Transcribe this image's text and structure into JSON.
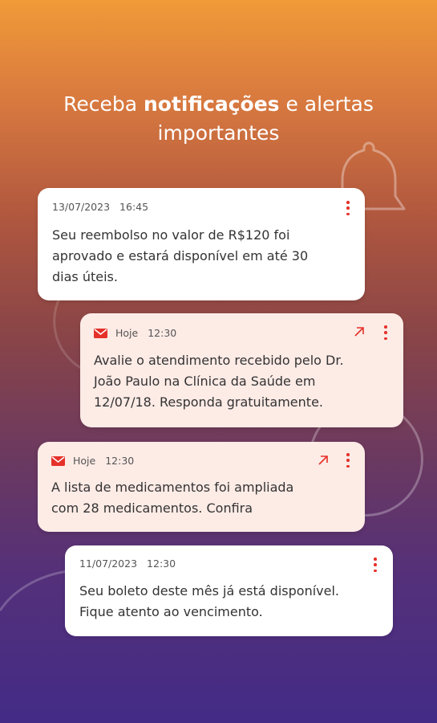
{
  "headline": {
    "part1": "Receba ",
    "bold": "notificações",
    "part2": " e alertas",
    "line2": "importantes"
  },
  "notifications": [
    {
      "date": "13/07/2023",
      "time": "16:45",
      "text_lines": [
        "Seu reembolso no valor de R$120 foi",
        "aprovado e estará disponível em até 30",
        "dias úteis."
      ]
    },
    {
      "date": "Hoje",
      "time": "12:30",
      "text_lines": [
        "Avalie o atendimento recebido pelo Dr.",
        "João Paulo na Clínica da Saúde em",
        "12/07/18. Responda gratuitamente."
      ]
    },
    {
      "date": "Hoje",
      "time": "12:30",
      "text_lines": [
        "A lista de medicamentos foi ampliada",
        "com 28 medicamentos. Confira"
      ]
    },
    {
      "date": "11/07/2023",
      "time": "12:30",
      "text_lines": [
        "Seu boleto deste mês já está disponível.",
        "Fique atento ao vencimento."
      ]
    }
  ],
  "icons": {
    "mail": "mail-icon",
    "kebab": "more-vertical-icon",
    "open": "arrow-up-right-icon",
    "bell": "bell-icon"
  },
  "colors": {
    "accent": "#e5312a",
    "card_white": "#ffffff",
    "card_pink": "#fdebe6",
    "gradient_top": "#f09a38",
    "gradient_bottom": "#432b86"
  }
}
